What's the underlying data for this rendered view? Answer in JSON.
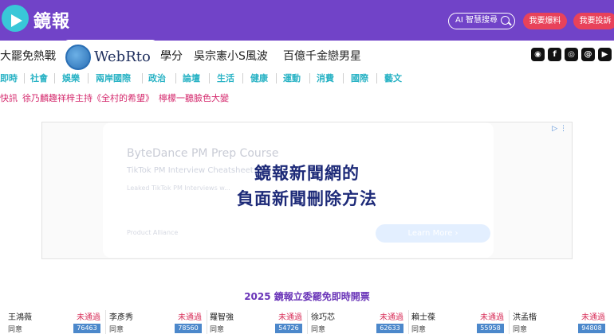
{
  "header": {
    "logo_text": "鏡報",
    "ai_search_label": "AI 智慧搜尋",
    "tip_button": "我要爆料",
    "complain_button": "我要投訴",
    "bg_color": "#7143c8"
  },
  "trending": [
    "大罷免熱戰",
    "學分",
    "吳宗憲小S風波",
    "百億千金戀男星"
  ],
  "social_icons": [
    "line-icon",
    "facebook-icon",
    "instagram-icon",
    "threads-icon",
    "youtube-icon"
  ],
  "overlay_logo": {
    "text": "WebRto"
  },
  "categories": [
    "即時",
    "社會",
    "娛樂",
    "兩岸國際",
    "政治",
    "論壇",
    "生活",
    "健康",
    "運動",
    "消費",
    "國際",
    "藝文"
  ],
  "breaking": {
    "label": "快訊",
    "items": [
      "徐乃麟趣祥梓主持《全村的希望》",
      "檸檬一聽臉色大變"
    ]
  },
  "ad": {
    "title": "ByteDance PM Prep Course",
    "subtitle": "TikTok PM Interview Cheatsheet",
    "line2": "Leaked TikTok PM Interviews w...",
    "brand": "Product Alliance",
    "button": "Learn More",
    "info": "▷ ⋮"
  },
  "overlay_text": {
    "line1": "鏡報新聞網的",
    "line2": "負面新聞刪除方法"
  },
  "recall": {
    "title": "2025 鏡報立委罷免即時開票",
    "candidates": [
      {
        "name": "王鴻薇",
        "status": "未通過",
        "agree_label": "同意",
        "count": "76463"
      },
      {
        "name": "李彥秀",
        "status": "未通過",
        "agree_label": "同意",
        "count": "78560"
      },
      {
        "name": "羅智強",
        "status": "未通過",
        "agree_label": "同意",
        "count": "54726"
      },
      {
        "name": "徐巧芯",
        "status": "未通過",
        "agree_label": "同意",
        "count": "62633"
      },
      {
        "name": "賴士葆",
        "status": "未通過",
        "agree_label": "同意",
        "count": "55958"
      },
      {
        "name": "洪孟楷",
        "status": "未通過",
        "agree_label": "同意",
        "count": "94808"
      }
    ]
  }
}
